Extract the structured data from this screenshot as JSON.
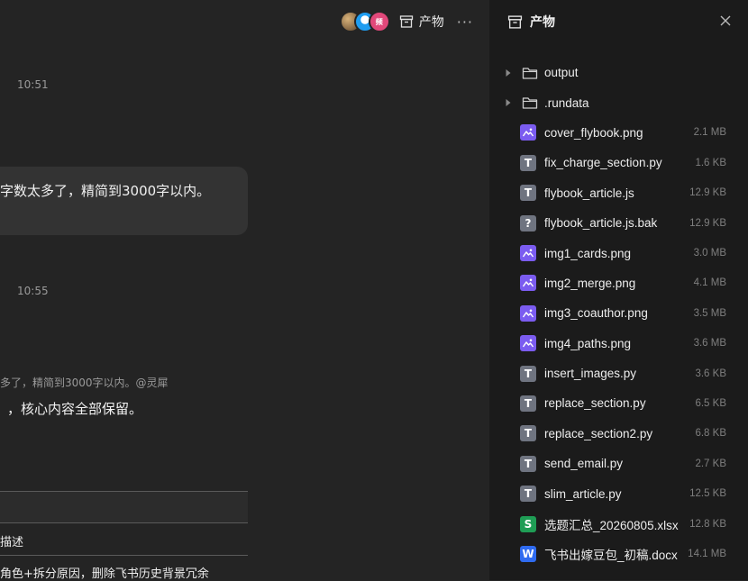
{
  "chat": {
    "time1": "10:51",
    "time2": "10:55",
    "bubble_text": "字数太多了，精简到3000字以内。",
    "quote_text": "多了，精简到3000字以内。@灵犀",
    "reply_text": "，核心内容全部保留。",
    "table_cell_1": "描述",
    "table_cell_2": "角色+拆分原因，删除飞书历史背景冗余"
  },
  "topbar": {
    "avatar_badge": "频",
    "artifact_label": "产物",
    "more_label": "···"
  },
  "panel": {
    "title": "产物",
    "items": [
      {
        "type": "folder",
        "name": "output",
        "size": ""
      },
      {
        "type": "folder",
        "name": ".rundata",
        "size": ""
      },
      {
        "type": "image",
        "name": "cover_flybook.png",
        "size": "2.1 MB"
      },
      {
        "type": "text",
        "name": "fix_charge_section.py",
        "size": "1.6 KB"
      },
      {
        "type": "text",
        "name": "flybook_article.js",
        "size": "12.9 KB"
      },
      {
        "type": "unknown",
        "name": "flybook_article.js.bak",
        "size": "12.9 KB"
      },
      {
        "type": "image",
        "name": "img1_cards.png",
        "size": "3.0 MB"
      },
      {
        "type": "image",
        "name": "img2_merge.png",
        "size": "4.1 MB"
      },
      {
        "type": "image",
        "name": "img3_coauthor.png",
        "size": "3.5 MB"
      },
      {
        "type": "image",
        "name": "img4_paths.png",
        "size": "3.6 MB"
      },
      {
        "type": "text",
        "name": "insert_images.py",
        "size": "3.6 KB"
      },
      {
        "type": "text",
        "name": "replace_section.py",
        "size": "6.5 KB"
      },
      {
        "type": "text",
        "name": "replace_section2.py",
        "size": "6.8 KB"
      },
      {
        "type": "text",
        "name": "send_email.py",
        "size": "2.7 KB"
      },
      {
        "type": "text",
        "name": "slim_article.py",
        "size": "12.5 KB"
      },
      {
        "type": "xlsx",
        "name": "选题汇总_20260805.xlsx",
        "size": "12.8 KB"
      },
      {
        "type": "docx",
        "name": "飞书出嫁豆包_初稿.docx",
        "size": "14.1 MB"
      }
    ]
  },
  "icon_letters": {
    "text": "T",
    "unknown": "?",
    "xlsx": "S",
    "docx": "W"
  },
  "colors": {
    "image": "#7b5cf0",
    "text": "#6f7480",
    "xlsx": "#1f9d55",
    "docx": "#2f6bf0",
    "panel_bg": "#1b1b1b",
    "chat_bg": "#242424"
  }
}
